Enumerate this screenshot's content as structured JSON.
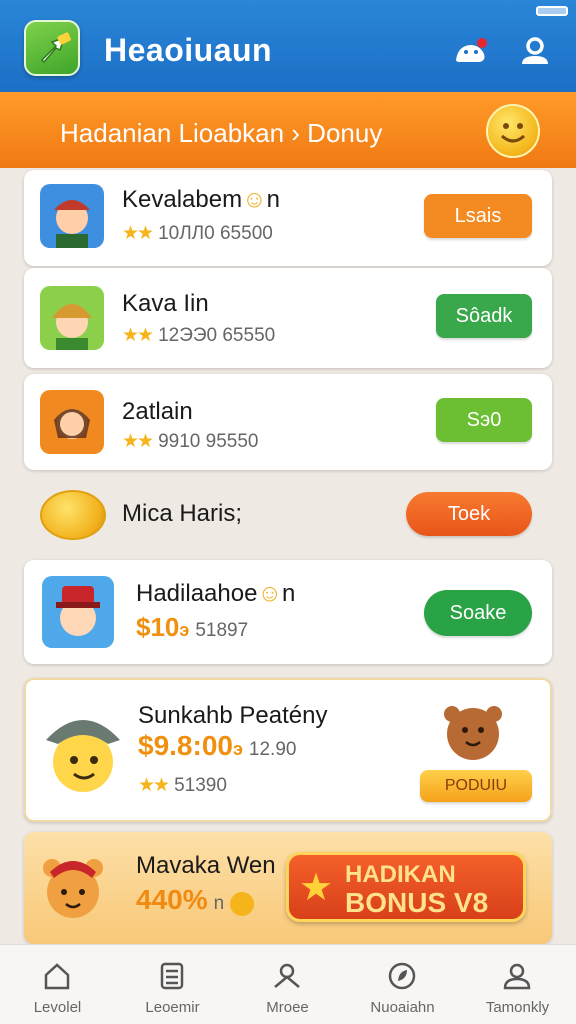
{
  "status": {
    "indicator": "battery"
  },
  "header": {
    "title": "Heaoiuaun",
    "icons": [
      "notification-bird-icon",
      "profile-icon"
    ]
  },
  "banner": {
    "text": "Hadanian  Lioabkan  ›  Donuy",
    "left_icon": "a-icon",
    "right_icon": "smiley-coin-icon"
  },
  "items": [
    {
      "name": "Kevalabem",
      "name_suffix": "n",
      "stars": "★★",
      "stats": "10ЛЛ0  65500",
      "button": "Lsais",
      "button_color": "#f38a22"
    },
    {
      "name": "Kava Iin",
      "stars": "★★",
      "stats": "12ЭЭ0  65550",
      "button": "Sôadk",
      "button_color": "#39a84a"
    },
    {
      "name": "2atlain",
      "stars": "★★",
      "stats": "9910  95550",
      "button": "Sэ0",
      "button_color": "#6cbf33"
    },
    {
      "name": "Mica Haris;",
      "button": "Toek",
      "button_color": "#f06020"
    },
    {
      "name": "Hadilaahoe",
      "name_suffix": "n",
      "money": "$10",
      "money_suffix": "э",
      "stats": "51897",
      "button": "Soake",
      "button_color": "#2aa246"
    },
    {
      "name": "Sunkahb Peatény",
      "money": "$9.8:00",
      "money_suffix": "э",
      "money_extra": "12.90",
      "stars": "★★",
      "stats": "51390",
      "button": "PODUIU",
      "button_color": "#f5a21a"
    }
  ],
  "promo": {
    "name": "Mavaka Wen",
    "percent": "440%",
    "percent_suffix": "n",
    "badge_line1": "HADIKAN",
    "badge_line2": "BONUS V8"
  },
  "nav": [
    {
      "label": "Levolel",
      "icon": "home-icon"
    },
    {
      "label": "Leoemir",
      "icon": "list-icon"
    },
    {
      "label": "Mroee",
      "icon": "map-pin-icon"
    },
    {
      "label": "Nuoaiahn",
      "icon": "leaf-icon"
    },
    {
      "label": "Tamonkly",
      "icon": "profile-icon"
    }
  ],
  "colors": {
    "header": "#1c6fc6",
    "banner": "#f07a12",
    "accent_orange": "#f38a22",
    "accent_green": "#39a84a"
  }
}
